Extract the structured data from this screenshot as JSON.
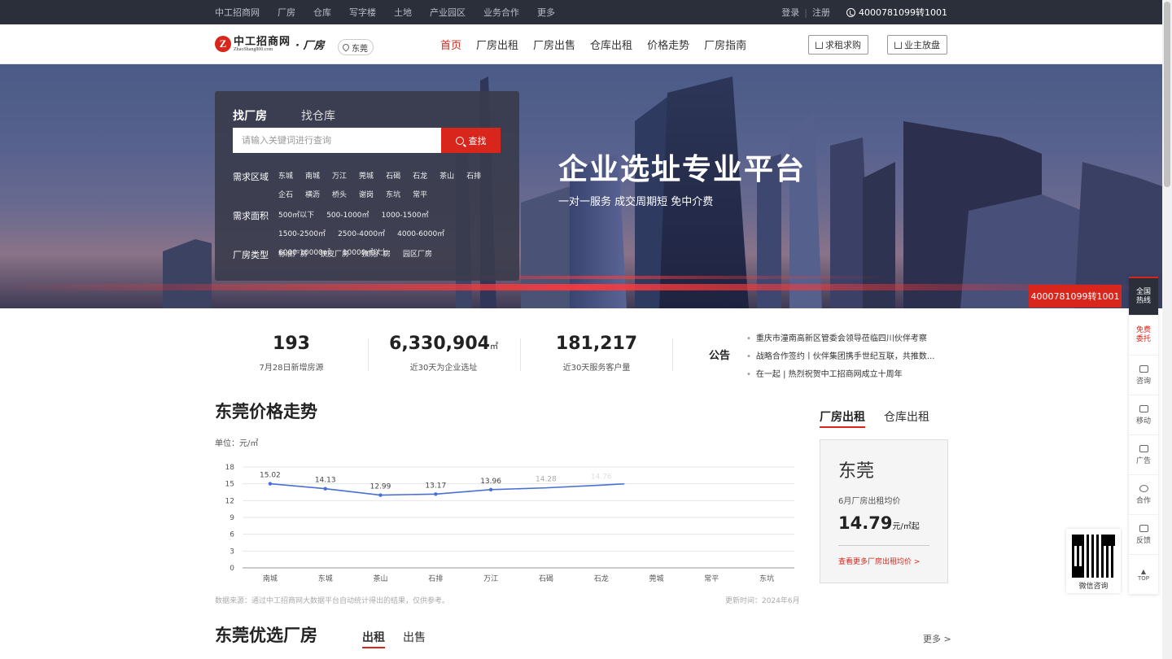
{
  "topbar": {
    "links": [
      "中工招商网",
      "厂房",
      "仓库",
      "写字楼",
      "土地",
      "产业园区",
      "业务合作",
      "更多"
    ],
    "login": "登录",
    "register": "注册",
    "sep": "|",
    "phone": "4000781099转1001"
  },
  "header": {
    "logo_mark": "Z",
    "logo_cn": "中工招商网",
    "logo_en": "ZhaoShang800.com",
    "logo_sub": "· 厂房",
    "city": "东莞",
    "nav": [
      "首页",
      "厂房出租",
      "厂房出售",
      "仓库出租",
      "价格走势",
      "厂房指南"
    ],
    "btn_want": "求租求购",
    "btn_owner": "业主放盘"
  },
  "banner": {
    "title": "企业选址专业平台",
    "subtitle": "一对一服务  成交周期短  免中介费"
  },
  "search": {
    "tab_factory": "找厂房",
    "tab_warehouse": "找仓库",
    "placeholder": "请输入关键词进行查询",
    "button": "查找",
    "area_label": "需求区域",
    "areas": [
      "东城",
      "南城",
      "万江",
      "莞城",
      "石碣",
      "石龙",
      "茶山",
      "石排",
      "企石",
      "横沥",
      "桥头",
      "谢岗",
      "东坑",
      "常平"
    ],
    "size_label": "需求面积",
    "sizes": [
      "500㎡以下",
      "500-1000㎡",
      "1000-1500㎡",
      "1500-2500㎡",
      "2500-4000㎡",
      "4000-6000㎡",
      "6000-10000㎡",
      "10000㎡以上"
    ],
    "type_label": "厂房类型",
    "types": [
      "标准厂房",
      "铁皮厂房",
      "独院厂房",
      "园区厂房"
    ]
  },
  "stats": [
    {
      "value": "193",
      "unit": "",
      "label": "7月28日新增房源"
    },
    {
      "value": "6,330,904",
      "unit": "㎡",
      "label": "近30天为企业选址"
    },
    {
      "value": "181,217",
      "unit": "",
      "label": "近30天服务客户量"
    }
  ],
  "notice": {
    "title": "公告",
    "items": [
      "重庆市潼南高新区管委会领导莅临四川伙伴考察",
      "战略合作签约丨伙伴集团携手世纪互联，共推数...",
      "在一起 | 热烈祝贺中工招商网成立十周年"
    ]
  },
  "price_section": {
    "title": "东莞价格走势",
    "unit": "单位：元/㎡",
    "source": "数据来源：通过中工招商网大数据平台自动统计得出的结果，仅供参考。",
    "updated": "更新时间：2024年6月"
  },
  "chart_data": {
    "type": "line",
    "categories": [
      "南城",
      "东城",
      "茶山",
      "石排",
      "万江",
      "石碣",
      "石龙",
      "莞城",
      "常平",
      "东坑"
    ],
    "values": [
      15.02,
      14.13,
      12.99,
      13.17,
      13.96,
      14.28,
      14.76,
      15.3,
      null,
      null
    ],
    "data_labels": [
      "15.02",
      "14.13",
      "12.99",
      "13.17",
      "13.96",
      "14.28",
      "14.76"
    ],
    "yticks": [
      0,
      3,
      6,
      9,
      12,
      15,
      18
    ],
    "ylim": [
      0,
      18
    ],
    "grid": true,
    "color": "#4a6fd4"
  },
  "price_card": {
    "tab_factory": "厂房出租",
    "tab_warehouse": "仓库出租",
    "city": "东莞",
    "label": "6月厂房出租均价",
    "value": "14.79",
    "unit": "元/㎡起",
    "link": "查看更多厂房出租均价 >"
  },
  "featured": {
    "title": "东莞优选厂房",
    "tab_rent": "出租",
    "tab_sale": "出售",
    "more": "更多 >"
  },
  "float": {
    "hotline": "4000781099转1001",
    "items": [
      "全国热线",
      "免费委托",
      "咨询",
      "移动",
      "广告",
      "合作",
      "反馈",
      "TOP"
    ],
    "qr_label": "微信咨询"
  }
}
